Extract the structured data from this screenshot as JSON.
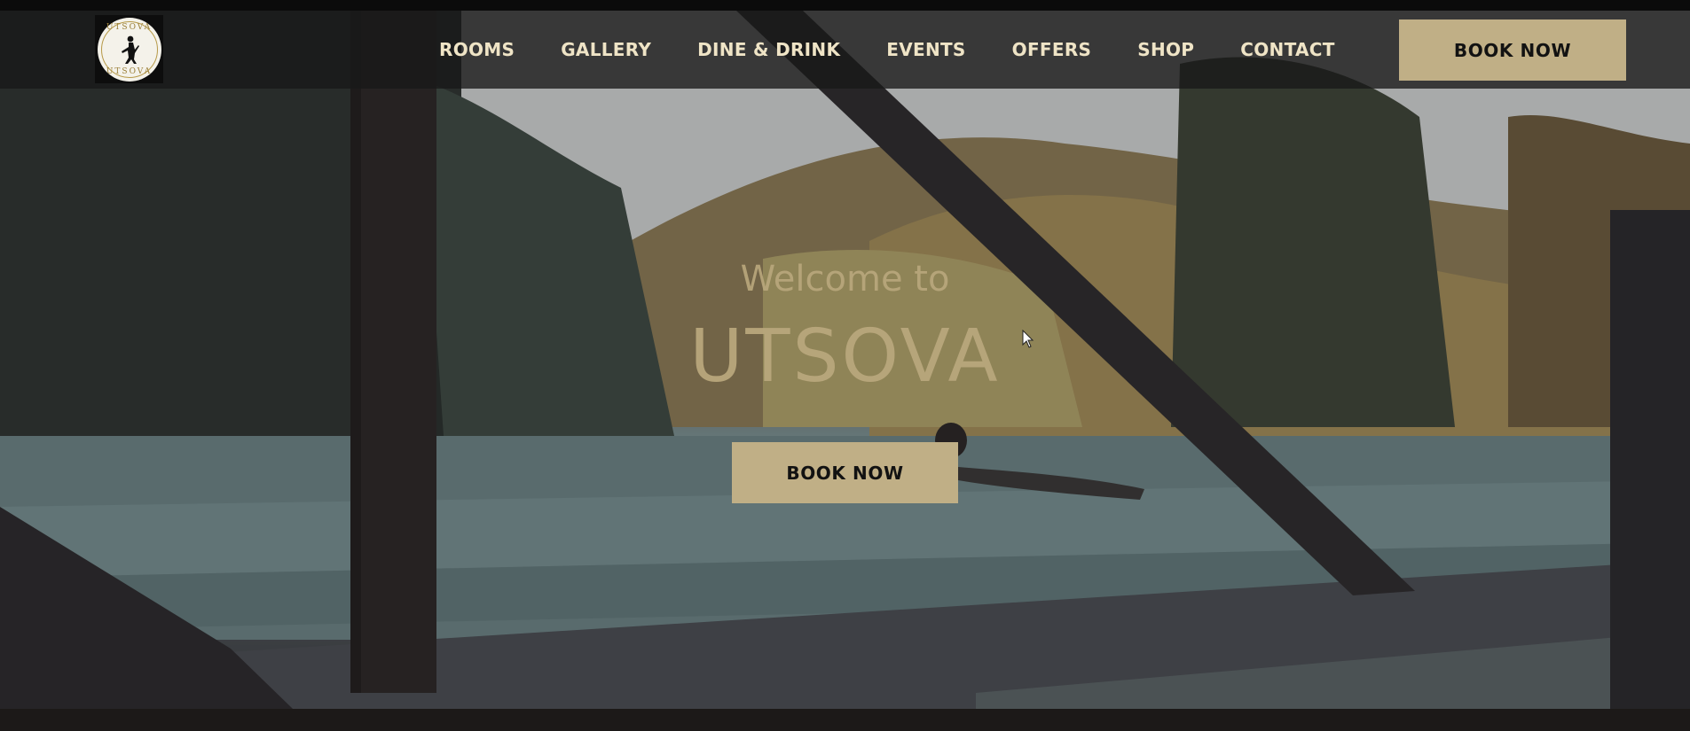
{
  "logo": {
    "text": "UTSOVA",
    "icon": "dancer-silhouette-icon"
  },
  "nav": {
    "items": [
      {
        "label": "ROOMS"
      },
      {
        "label": "GALLERY"
      },
      {
        "label": "DINE & DRINK"
      },
      {
        "label": "EVENTS"
      },
      {
        "label": "OFFERS"
      },
      {
        "label": "SHOP"
      },
      {
        "label": "CONTACT"
      }
    ],
    "book_label": "BOOK NOW"
  },
  "hero": {
    "welcome": "Welcome to",
    "brand": "UTSOVA",
    "book_label": "BOOK NOW"
  },
  "colors": {
    "accent": "#c0af86",
    "nav_text": "#efe4c6",
    "hero_text": "#b9a77c",
    "navbar_bg": "#181818"
  }
}
